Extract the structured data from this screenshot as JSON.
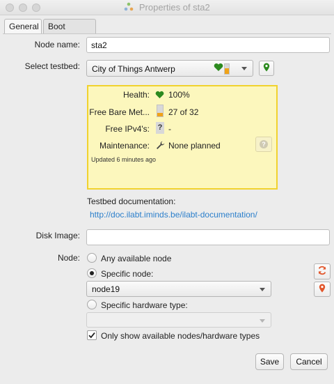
{
  "window": {
    "title": "Properties of sta2"
  },
  "tabs": [
    {
      "label": "General",
      "active": true
    },
    {
      "label": "Boot scripts",
      "active": false
    }
  ],
  "form": {
    "node_name_label": "Node name:",
    "node_name_value": "sta2",
    "testbed_label": "Select testbed:",
    "testbed_value": "City of Things Antwerp",
    "disk_image_label": "Disk Image:",
    "disk_image_value": "",
    "node_label": "Node:"
  },
  "testbed_info": {
    "health_label": "Health:",
    "health_value": "100%",
    "health_level": 1.0,
    "bare_metal_label": "Free Bare Met...",
    "bare_metal_value": "27 of 32",
    "bare_metal_fraction": 0.84,
    "ipv4_label": "Free IPv4's:",
    "ipv4_value": "-",
    "ipv4_icon": "?",
    "maintenance_label": "Maintenance:",
    "maintenance_value": "None planned",
    "updated": "Updated 6 minutes ago"
  },
  "documentation": {
    "label": "Testbed documentation:",
    "url": "http://doc.ilabt.iminds.be/ilabt-documentation/"
  },
  "node_options": {
    "any_label": "Any available node",
    "specific_label": "Specific node:",
    "specific_value": "node19",
    "hardware_label": "Specific hardware type:",
    "hardware_value": "",
    "only_available_label": "Only show available nodes/hardware types",
    "selected": "specific",
    "only_available_checked": true
  },
  "buttons": {
    "save": "Save",
    "cancel": "Cancel"
  },
  "colors": {
    "accent_green": "#2c8a1f",
    "info_bg": "#fcf7bd",
    "info_border": "#f1d22e",
    "link": "#2b7fcb",
    "refresh": "#e2552a"
  }
}
